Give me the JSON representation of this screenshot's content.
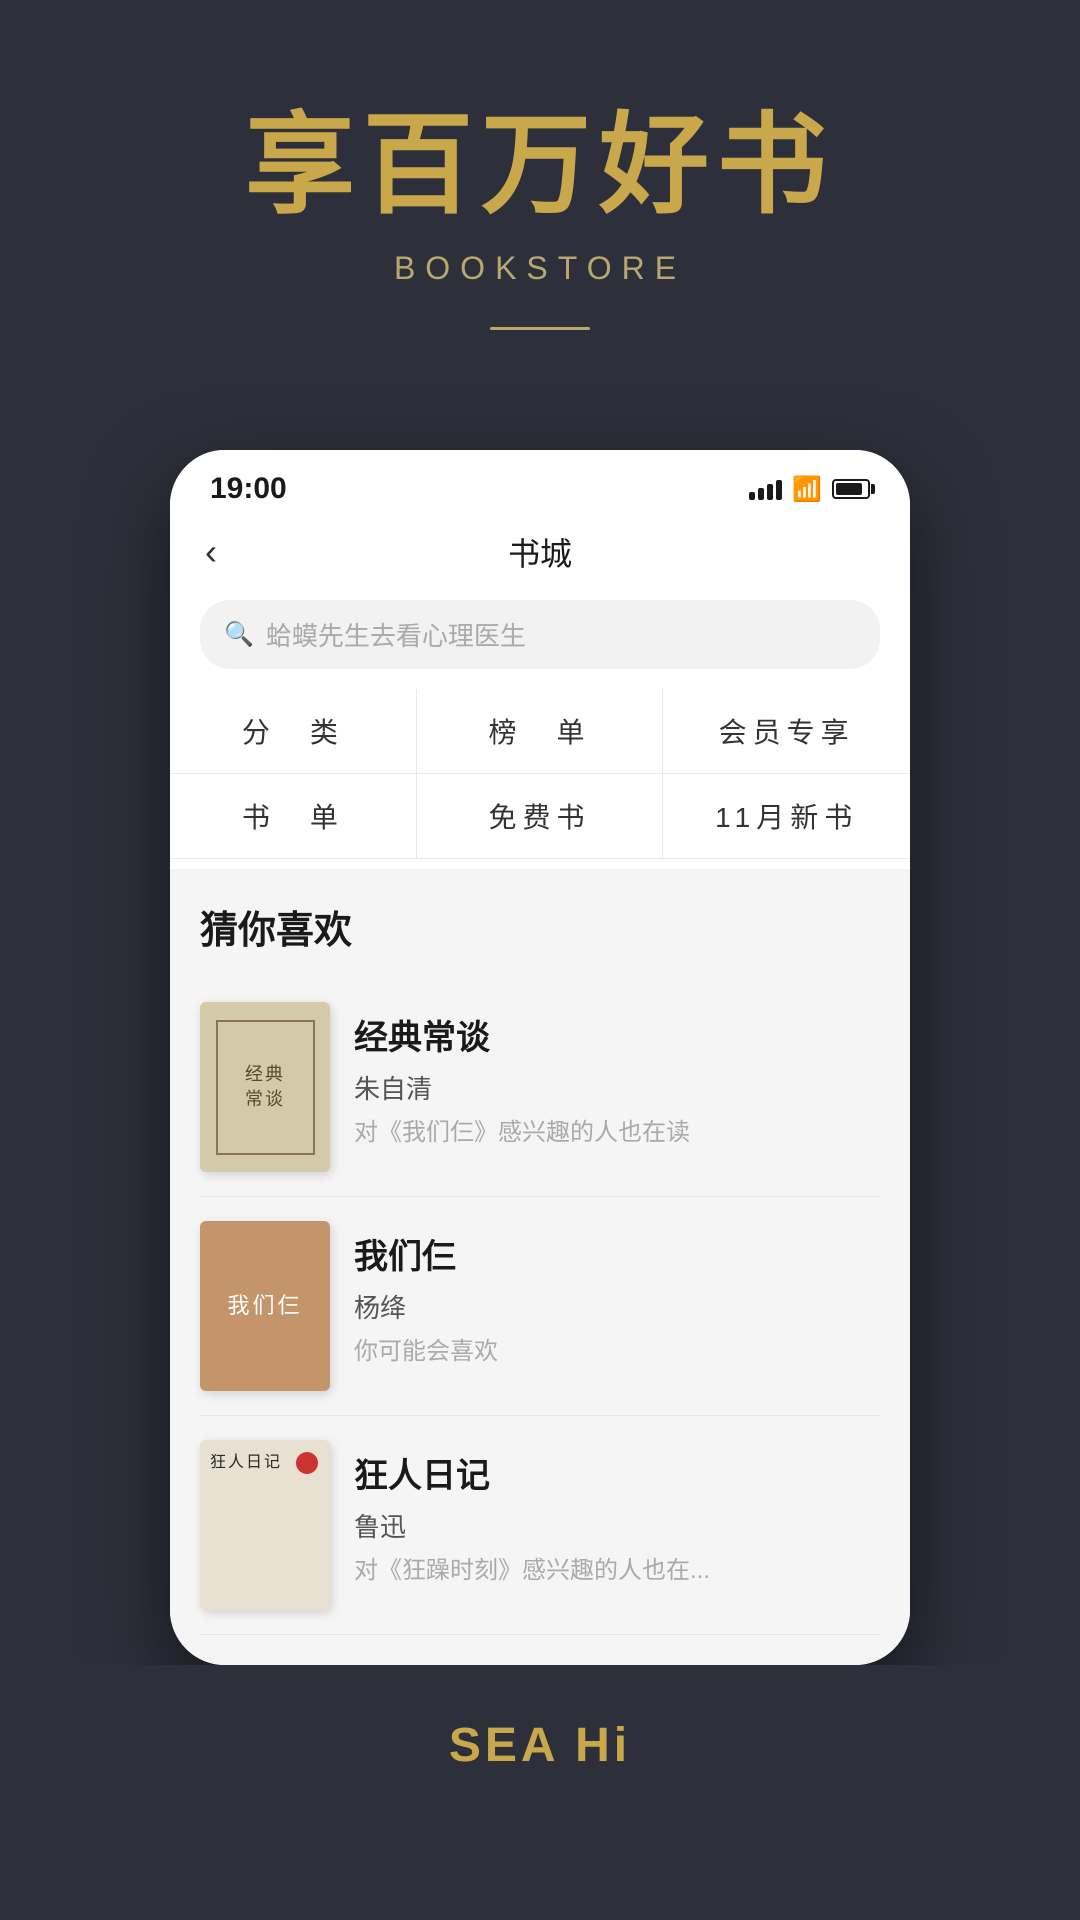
{
  "hero": {
    "title": "享百万好书",
    "subtitle": "BOOKSTORE"
  },
  "status_bar": {
    "time": "19:00"
  },
  "nav": {
    "title": "书城",
    "back_label": "‹"
  },
  "search": {
    "placeholder": "蛤蟆先生去看心理医生"
  },
  "categories": [
    {
      "label": "分　类"
    },
    {
      "label": "榜　单"
    },
    {
      "label": "会员专享"
    },
    {
      "label": "书　单"
    },
    {
      "label": "免费书"
    },
    {
      "label": "11月新书"
    }
  ],
  "recommendations": {
    "section_title": "猜你喜欢",
    "books": [
      {
        "title": "经典常谈",
        "author": "朱自清",
        "description": "对《我们仨》感兴趣的人也在读",
        "cover_title": "经典\n常谈"
      },
      {
        "title": "我们仨",
        "author": "杨绛",
        "description": "你可能会喜欢",
        "cover_title": "我们仨"
      },
      {
        "title": "狂人日记",
        "author": "鲁迅",
        "description": "对《狂躁时刻》感兴趣的人也在...",
        "cover_title": "狂人日记"
      }
    ]
  },
  "bottom": {
    "text": "SEA Hi"
  }
}
